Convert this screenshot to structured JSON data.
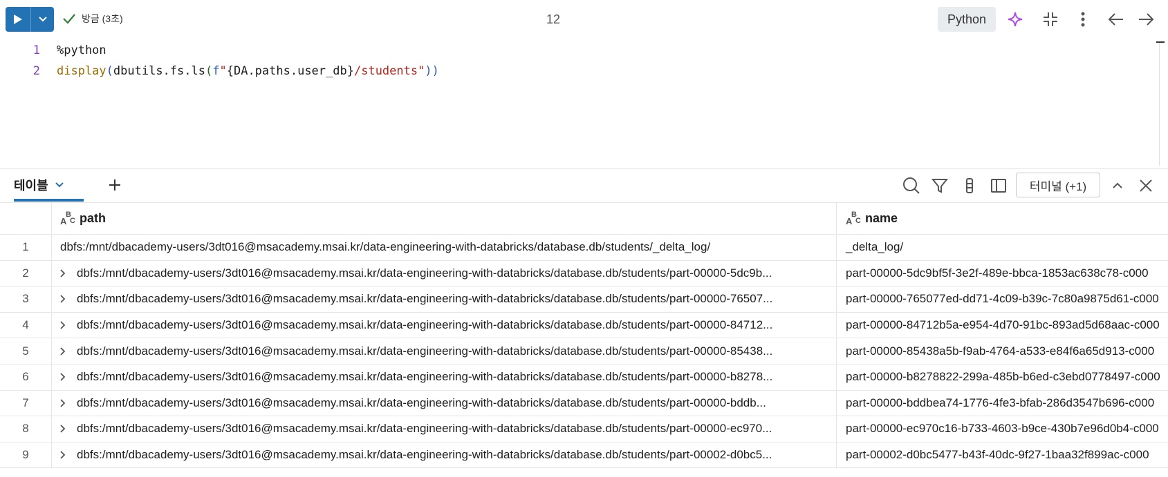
{
  "toolbar": {
    "status_text": "방금 (3초)",
    "cell_number": "12",
    "language": "Python"
  },
  "code": {
    "lines": [
      {
        "num": "1",
        "text": "%python"
      },
      {
        "num": "2",
        "fn": "display",
        "open_paren": "(",
        "call": "dbutils.fs.ls",
        "open_paren2": "(",
        "fprefix": "f",
        "str_open": "\"",
        "brace_open": "{",
        "expr": "DA.paths.user_db",
        "brace_close": "}",
        "str_rest": "/students\"",
        "close_parens": "))"
      }
    ]
  },
  "results": {
    "tab_label": "테이블",
    "terminal_label": "터미널 (+1)"
  },
  "table": {
    "columns": [
      {
        "type_icon": "string-type-icon",
        "label": "path"
      },
      {
        "type_icon": "string-type-icon",
        "label": "name"
      }
    ],
    "rows": [
      {
        "index": "1",
        "expandable": false,
        "path": "dbfs:/mnt/dbacademy-users/3dt016@msacademy.msai.kr/data-engineering-with-databricks/database.db/students/_delta_log/",
        "name": "_delta_log/"
      },
      {
        "index": "2",
        "expandable": true,
        "path": "dbfs:/mnt/dbacademy-users/3dt016@msacademy.msai.kr/data-engineering-with-databricks/database.db/students/part-00000-5dc9b...",
        "name": "part-00000-5dc9bf5f-3e2f-489e-bbca-1853ac638c78-c000"
      },
      {
        "index": "3",
        "expandable": true,
        "path": "dbfs:/mnt/dbacademy-users/3dt016@msacademy.msai.kr/data-engineering-with-databricks/database.db/students/part-00000-76507...",
        "name": "part-00000-765077ed-dd71-4c09-b39c-7c80a9875d61-c000"
      },
      {
        "index": "4",
        "expandable": true,
        "path": "dbfs:/mnt/dbacademy-users/3dt016@msacademy.msai.kr/data-engineering-with-databricks/database.db/students/part-00000-84712...",
        "name": "part-00000-84712b5a-e954-4d70-91bc-893ad5d68aac-c000"
      },
      {
        "index": "5",
        "expandable": true,
        "path": "dbfs:/mnt/dbacademy-users/3dt016@msacademy.msai.kr/data-engineering-with-databricks/database.db/students/part-00000-85438...",
        "name": "part-00000-85438a5b-f9ab-4764-a533-e84f6a65d913-c000"
      },
      {
        "index": "6",
        "expandable": true,
        "path": "dbfs:/mnt/dbacademy-users/3dt016@msacademy.msai.kr/data-engineering-with-databricks/database.db/students/part-00000-b8278...",
        "name": "part-00000-b8278822-299a-485b-b6ed-c3ebd0778497-c000"
      },
      {
        "index": "7",
        "expandable": true,
        "path": "dbfs:/mnt/dbacademy-users/3dt016@msacademy.msai.kr/data-engineering-with-databricks/database.db/students/part-00000-bddb...",
        "name": "part-00000-bddbea74-1776-4fe3-bfab-286d3547b696-c000"
      },
      {
        "index": "8",
        "expandable": true,
        "path": "dbfs:/mnt/dbacademy-users/3dt016@msacademy.msai.kr/data-engineering-with-databricks/database.db/students/part-00000-ec970...",
        "name": "part-00000-ec970c16-b733-4603-b9ce-430b7e96d0b4-c000"
      },
      {
        "index": "9",
        "expandable": true,
        "path": "dbfs:/mnt/dbacademy-users/3dt016@msacademy.msai.kr/data-engineering-with-databricks/database.db/students/part-00002-d0bc5...",
        "name": "part-00002-d0bc5477-b43f-40dc-9f27-1baa32f899ac-c000"
      }
    ]
  },
  "colors": {
    "accent": "#2272b4",
    "success": "#2e7d32",
    "assistant": "#b04de0"
  }
}
